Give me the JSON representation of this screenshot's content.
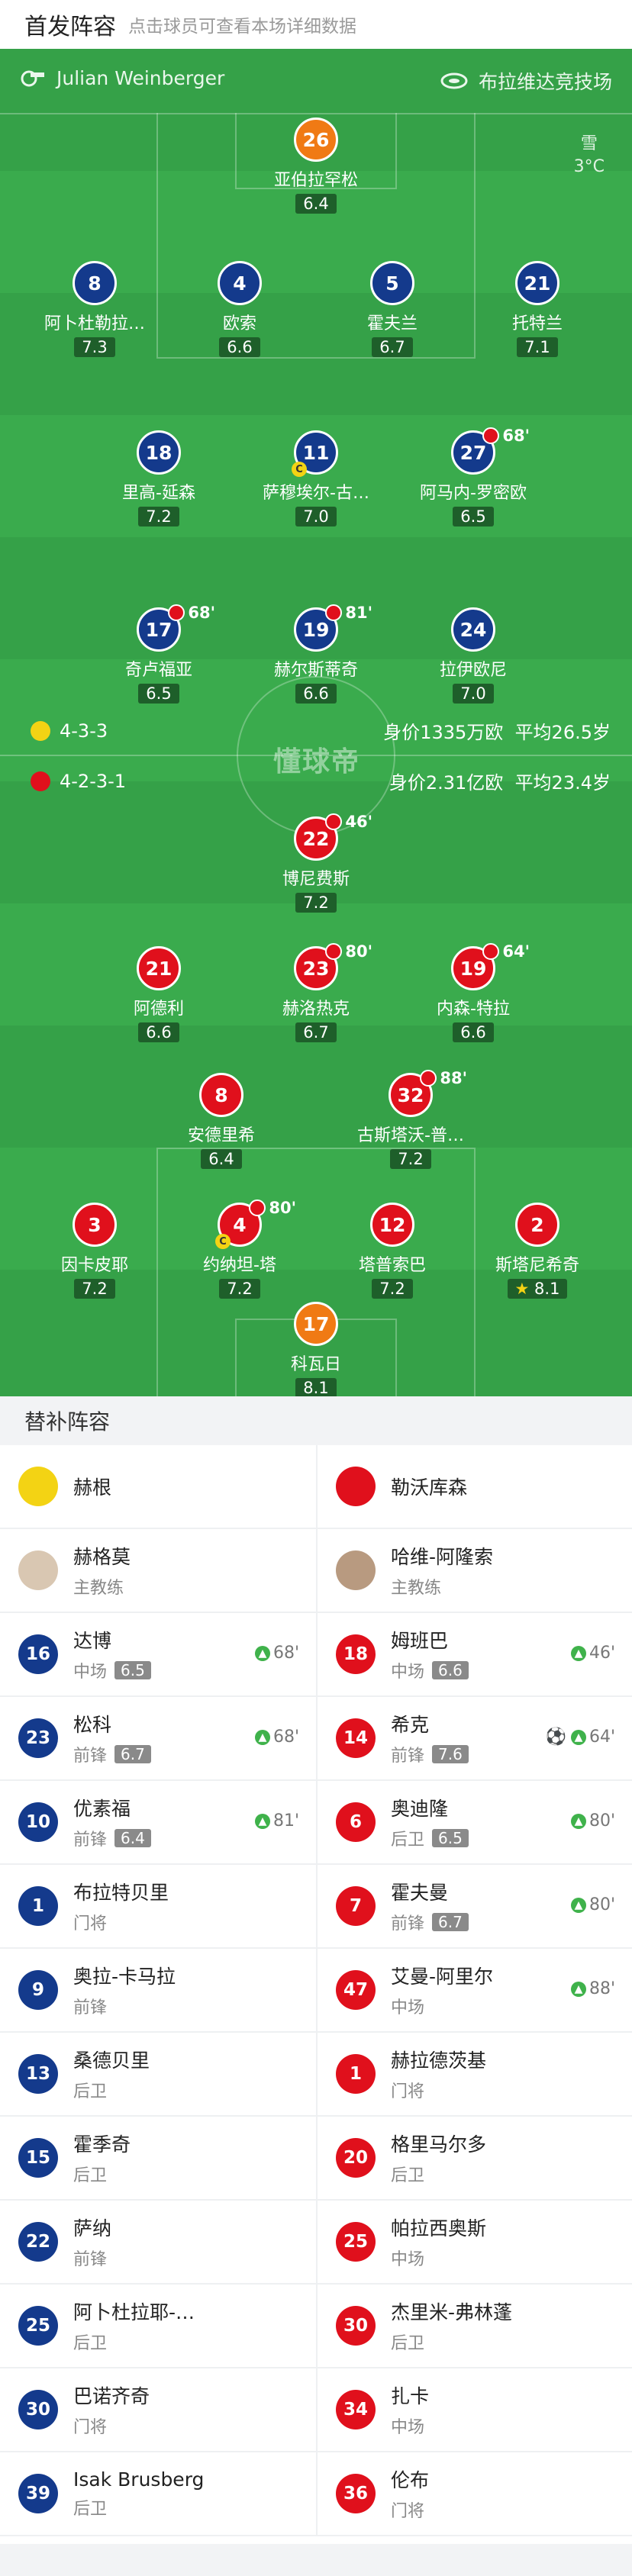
{
  "header": {
    "title": "首发阵容",
    "subtitle": "点击球员可查看本场详细数据"
  },
  "match": {
    "referee": "Julian Weinberger",
    "venue": "布拉维达竞技场",
    "weather": "雪",
    "temperature": "3°C",
    "watermark": "懂球帝"
  },
  "home_team": {
    "formation": "4-3-3",
    "value": "身价1335万欧",
    "age": "平均26.5岁"
  },
  "away_team": {
    "formation": "4-2-3-1",
    "value": "身价2.31亿欧",
    "age": "平均23.4岁"
  },
  "home_lineup": [
    {
      "num": "26",
      "name": "亚伯拉罕松",
      "rating": "6.4"
    },
    {
      "num": "8",
      "name": "阿卜杜勒拉…",
      "rating": "7.3"
    },
    {
      "num": "4",
      "name": "欧索",
      "rating": "6.6"
    },
    {
      "num": "5",
      "name": "霍夫兰",
      "rating": "6.7"
    },
    {
      "num": "21",
      "name": "托特兰",
      "rating": "7.1"
    },
    {
      "num": "18",
      "name": "里高-延森",
      "rating": "7.2"
    },
    {
      "num": "11",
      "name": "萨穆埃尔-古…",
      "rating": "7.0"
    },
    {
      "num": "27",
      "name": "阿马内-罗密欧",
      "rating": "6.5",
      "sub": "68'"
    },
    {
      "num": "17",
      "name": "奇卢福亚",
      "rating": "6.5",
      "sub": "68'"
    },
    {
      "num": "19",
      "name": "赫尔斯蒂奇",
      "rating": "6.6",
      "sub": "81'"
    },
    {
      "num": "24",
      "name": "拉伊欧尼",
      "rating": "7.0"
    }
  ],
  "away_lineup": [
    {
      "num": "22",
      "name": "博尼费斯",
      "rating": "7.2",
      "sub": "46'"
    },
    {
      "num": "21",
      "name": "阿德利",
      "rating": "6.6"
    },
    {
      "num": "23",
      "name": "赫洛热克",
      "rating": "6.7",
      "sub": "80'"
    },
    {
      "num": "19",
      "name": "内森-特拉",
      "rating": "6.6",
      "sub": "64'"
    },
    {
      "num": "8",
      "name": "安德里希",
      "rating": "6.4"
    },
    {
      "num": "32",
      "name": "古斯塔沃-普…",
      "rating": "7.2",
      "sub": "88'"
    },
    {
      "num": "3",
      "name": "因卡皮耶",
      "rating": "7.2"
    },
    {
      "num": "4",
      "name": "约纳坦-塔",
      "rating": "7.2",
      "sub": "80'"
    },
    {
      "num": "12",
      "name": "塔普索巴",
      "rating": "7.2"
    },
    {
      "num": "2",
      "name": "斯塔尼希奇",
      "rating": "8.1"
    },
    {
      "num": "17",
      "name": "科瓦日",
      "rating": "8.1"
    }
  ],
  "bench": {
    "title": "替补阵容",
    "home_name": "赫根",
    "away_name": "勒沃库森",
    "home_coach": {
      "name": "赫格莫",
      "role": "主教练"
    },
    "away_coach": {
      "name": "哈维-阿隆索",
      "role": "主教练"
    },
    "home_subs": [
      {
        "num": "16",
        "name": "达博",
        "pos": "中场",
        "rating": "6.5",
        "time": "68'"
      },
      {
        "num": "23",
        "name": "松科",
        "pos": "前锋",
        "rating": "6.7",
        "time": "68'"
      },
      {
        "num": "10",
        "name": "优素福",
        "pos": "前锋",
        "rating": "6.4",
        "time": "81'"
      },
      {
        "num": "1",
        "name": "布拉特贝里",
        "pos": "门将"
      },
      {
        "num": "9",
        "name": "奥拉-卡马拉",
        "pos": "前锋"
      },
      {
        "num": "13",
        "name": "桑德贝里",
        "pos": "后卫"
      },
      {
        "num": "15",
        "name": "霍季奇",
        "pos": "后卫"
      },
      {
        "num": "22",
        "name": "萨纳",
        "pos": "前锋"
      },
      {
        "num": "25",
        "name": "阿卜杜拉耶-…",
        "pos": "后卫"
      },
      {
        "num": "30",
        "name": "巴诺齐奇",
        "pos": "门将"
      },
      {
        "num": "39",
        "name": "Isak Brusberg",
        "pos": "后卫"
      }
    ],
    "away_subs": [
      {
        "num": "18",
        "name": "姆班巴",
        "pos": "中场",
        "rating": "6.6",
        "time": "46'"
      },
      {
        "num": "14",
        "name": "希克",
        "pos": "前锋",
        "rating": "7.6",
        "time": "64'"
      },
      {
        "num": "6",
        "name": "奥迪隆",
        "pos": "后卫",
        "rating": "6.5",
        "time": "80'"
      },
      {
        "num": "7",
        "name": "霍夫曼",
        "pos": "前锋",
        "rating": "6.7",
        "time": "80'"
      },
      {
        "num": "47",
        "name": "艾曼-阿里尔",
        "pos": "中场",
        "time": "88'"
      },
      {
        "num": "1",
        "name": "赫拉德茨基",
        "pos": "门将"
      },
      {
        "num": "20",
        "name": "格里马尔多",
        "pos": "后卫"
      },
      {
        "num": "25",
        "name": "帕拉西奥斯",
        "pos": "中场"
      },
      {
        "num": "30",
        "name": "杰里米-弗林蓬",
        "pos": "后卫"
      },
      {
        "num": "34",
        "name": "扎卡",
        "pos": "中场"
      },
      {
        "num": "36",
        "name": "伦布",
        "pos": "门将"
      }
    ]
  }
}
